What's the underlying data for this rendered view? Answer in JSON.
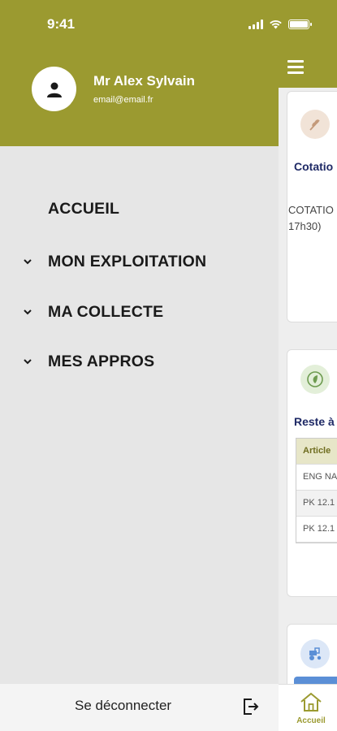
{
  "status_bar": {
    "time": "9:41"
  },
  "user": {
    "name": "Mr Alex Sylvain",
    "email": "email@email.fr"
  },
  "menu": [
    {
      "label": "ACCUEIL",
      "expandable": false
    },
    {
      "label": "MON EXPLOITATION",
      "expandable": true
    },
    {
      "label": "MA COLLECTE",
      "expandable": true
    },
    {
      "label": "MES APPROS",
      "expandable": true
    }
  ],
  "footer": {
    "logout_label": "Se déconnecter"
  },
  "background": {
    "card1": {
      "title": "Cotatio",
      "line1": "COTATIO",
      "line2": "17h30)"
    },
    "card2": {
      "title": "Reste à",
      "table_header": "Article",
      "rows": [
        "ENG NA",
        "PK 12.1",
        "PK 12.1"
      ]
    },
    "tabbar": {
      "home_label": "Accueil"
    }
  },
  "colors": {
    "brand": "#9b9a30",
    "drawer_bg": "#e6e6e6",
    "title_navy": "#1f2a66",
    "accent_blue": "#5b8fd6"
  }
}
